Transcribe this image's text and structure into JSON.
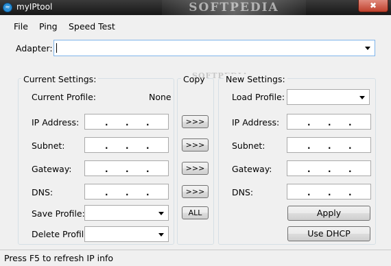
{
  "window": {
    "title": "myIPtool",
    "watermark": "SOFTPEDIA",
    "close_label": "✖"
  },
  "menu": [
    "File",
    "Ping",
    "Speed Test"
  ],
  "adapter": {
    "label": "Adapter:",
    "value": ""
  },
  "current": {
    "title": "Current Settings:",
    "profile_label": "Current Profile:",
    "profile_value": "None",
    "fields": [
      {
        "label": "IP Address:"
      },
      {
        "label": "Subnet:"
      },
      {
        "label": "Gateway:"
      },
      {
        "label": "DNS:"
      }
    ],
    "save_label": "Save Profile:",
    "delete_label": "Delete Profile:"
  },
  "copy": {
    "title": "Copy",
    "arrow_label": ">>>",
    "all_label": "ALL"
  },
  "new": {
    "title": "New Settings:",
    "load_label": "Load Profile:",
    "fields": [
      {
        "label": "IP Address:"
      },
      {
        "label": "Subnet:"
      },
      {
        "label": "Gateway:"
      },
      {
        "label": "DNS:"
      }
    ],
    "apply_label": "Apply",
    "dhcp_label": "Use DHCP"
  },
  "watermark_mid": "SOFTPEDIA",
  "status": "Press F5 to refresh IP info"
}
